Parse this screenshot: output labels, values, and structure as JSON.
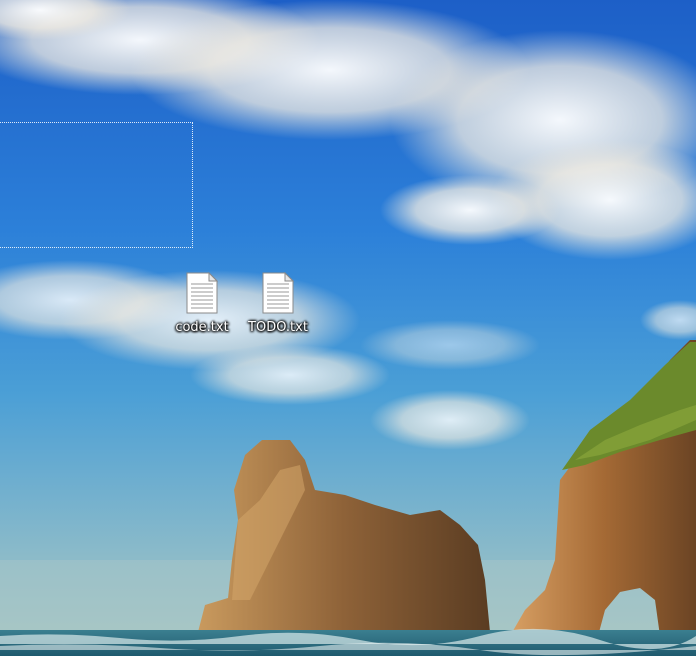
{
  "desktop": {
    "icons": [
      {
        "label": "code.txt",
        "icon": "text-file-icon"
      },
      {
        "label": "TODO.txt",
        "icon": "text-file-icon"
      }
    ]
  },
  "colors": {
    "sky_top": "#1f63c9",
    "sky_bottom": "#9cc2c4",
    "sea": "#2f6e86",
    "rock": "#9a6a3c",
    "grass": "#5f8a2a",
    "label_text": "#ffffff"
  }
}
